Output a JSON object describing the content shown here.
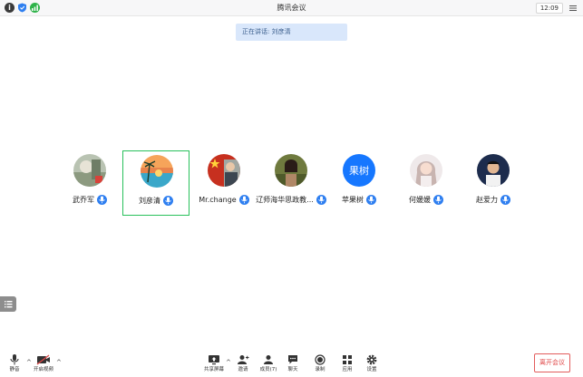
{
  "titlebar": {
    "title": "腾讯会议",
    "time": "12:09"
  },
  "speaking_banner": {
    "label": "正在讲话: 刘彦清"
  },
  "participants": [
    {
      "name": "武乔军",
      "avatar_kind": "photo",
      "active": false
    },
    {
      "name": "刘彦清",
      "avatar_kind": "photo",
      "active": true
    },
    {
      "name": "Mr.change",
      "avatar_kind": "photo",
      "active": false
    },
    {
      "name": "辽师海华思政教...",
      "avatar_kind": "photo",
      "active": false
    },
    {
      "name": "苹果树",
      "avatar_kind": "text",
      "avatar_text": "果树",
      "active": false
    },
    {
      "name": "何媛媛",
      "avatar_kind": "photo",
      "active": false
    },
    {
      "name": "赵爱力",
      "avatar_kind": "photo",
      "active": false
    }
  ],
  "toolbar": {
    "mute": "静音",
    "video": "开启视频",
    "share": "共享屏幕",
    "invite": "邀请",
    "members": "成员(7)",
    "chat": "聊天",
    "record": "录制",
    "apps": "应用",
    "settings": "设置",
    "leave": "离开会议"
  },
  "colors": {
    "accent": "#2f7ff0",
    "active_border": "#28c05b",
    "leave": "#e04848"
  }
}
